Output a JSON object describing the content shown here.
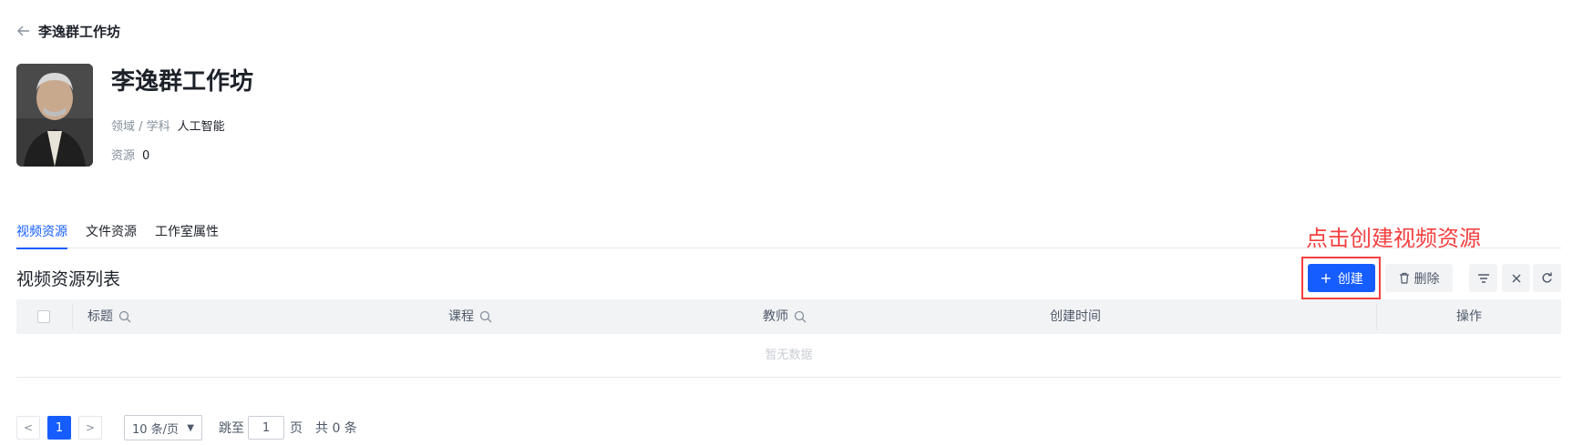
{
  "header": {
    "back_title": "李逸群工作坊"
  },
  "profile": {
    "name": "李逸群工作坊",
    "field_label": "领域 / 学科",
    "field_value": "人工智能",
    "resource_label": "资源",
    "resource_value": "0"
  },
  "tabs": [
    {
      "label": "视频资源",
      "active": true
    },
    {
      "label": "文件资源",
      "active": false
    },
    {
      "label": "工作室属性",
      "active": false
    }
  ],
  "annotation": "点击创建视频资源",
  "list": {
    "title": "视频资源列表",
    "create_label": "创建",
    "delete_label": "删除"
  },
  "table": {
    "columns": [
      "标题",
      "课程",
      "教师",
      "创建时间",
      "操作"
    ],
    "empty_text": "暂无数据"
  },
  "pagination": {
    "current_page": "1",
    "page_size": "10 条/页",
    "jump_label": "跳至",
    "jump_value": "1",
    "page_unit": "页",
    "total": "共 0 条"
  },
  "colors": {
    "primary": "#165dff",
    "annotation": "#f53f3f"
  },
  "icons": [
    "back-arrow-icon",
    "plus-icon",
    "trash-icon",
    "filter-icon",
    "close-icon",
    "refresh-icon",
    "search-icon",
    "chevron-left-icon",
    "chevron-right-icon",
    "caret-down-icon"
  ]
}
